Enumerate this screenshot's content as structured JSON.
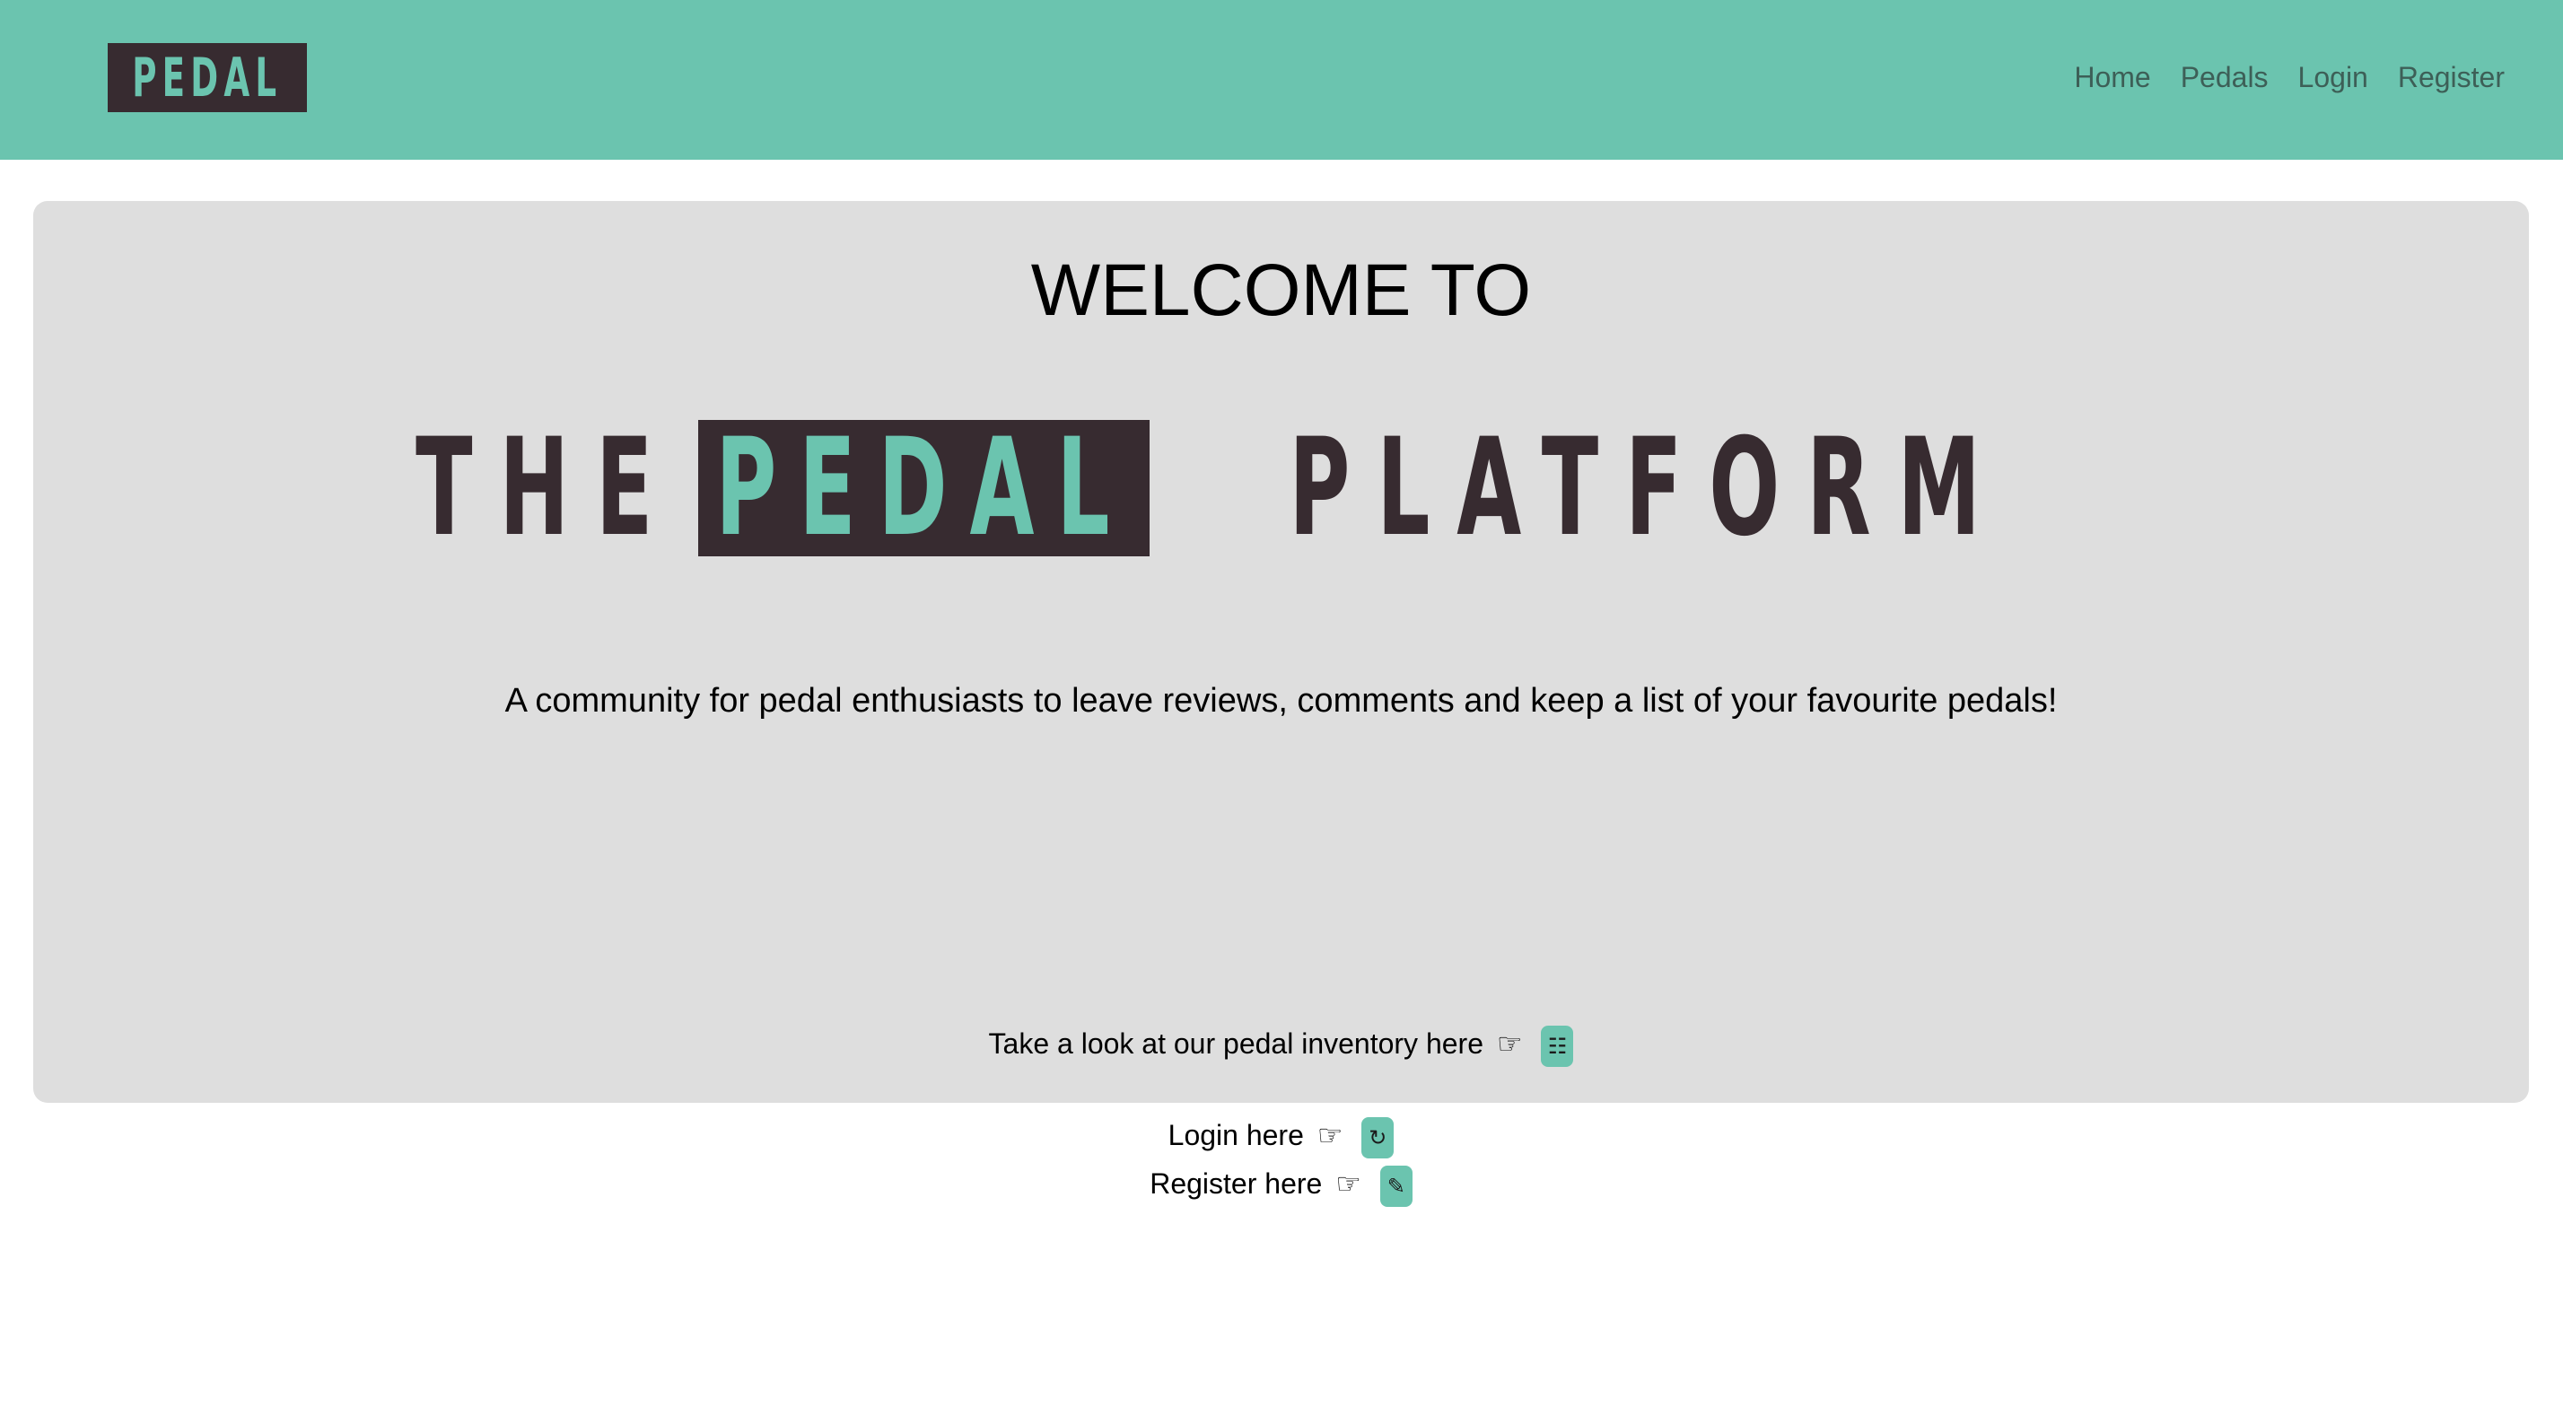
{
  "navbar": {
    "logo_text": "PEDAL",
    "links": [
      {
        "label": "Home"
      },
      {
        "label": "Pedals"
      },
      {
        "label": "Login"
      },
      {
        "label": "Register"
      }
    ],
    "colors": {
      "background": "#6bc4af",
      "logo_bg": "#372b30"
    }
  },
  "main": {
    "welcome": "WELCOME TO",
    "brand": {
      "the": "THE",
      "pedal": "PEDAL",
      "platform": "PLATFORM"
    },
    "tagline": "A community for pedal enthusiasts to leave reviews, comments and keep a list of your favourite pedals!",
    "cta": [
      {
        "text": "Take a look at our pedal inventory here",
        "pointer": "☞",
        "icon": "list-icon",
        "glyph": "☷"
      },
      {
        "text": "Login here",
        "pointer": "☞",
        "icon": "login-icon",
        "glyph": "↻"
      },
      {
        "text": "Register here",
        "pointer": "☞",
        "icon": "pencil-icon",
        "glyph": "✎"
      }
    ]
  }
}
